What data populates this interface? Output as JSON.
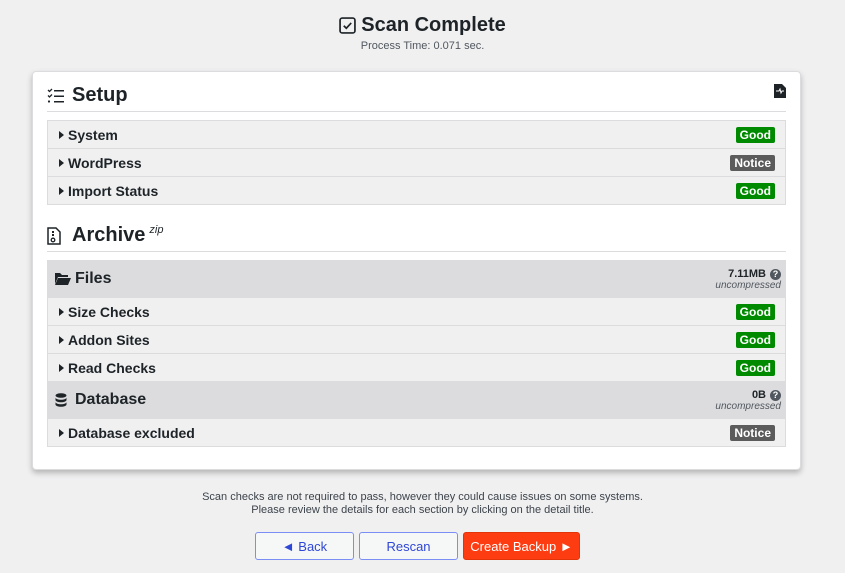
{
  "header": {
    "title": "Scan Complete",
    "title_icon": "check-square-icon",
    "process_time": "Process Time: 0.071 sec."
  },
  "setup": {
    "title": "Setup",
    "icon": "checklist-icon",
    "report_icon": "file-report-icon",
    "rows": [
      {
        "label": "System",
        "status": "Good"
      },
      {
        "label": "WordPress",
        "status": "Notice"
      },
      {
        "label": "Import Status",
        "status": "Good"
      }
    ]
  },
  "archive": {
    "title": "Archive",
    "format": "zip",
    "icon": "file-zip-icon",
    "files": {
      "title": "Files",
      "icon": "folder-open-icon",
      "size": "7.11MB",
      "size_note": "uncompressed",
      "rows": [
        {
          "label": "Size Checks",
          "status": "Good"
        },
        {
          "label": "Addon Sites",
          "status": "Good"
        },
        {
          "label": "Read Checks",
          "status": "Good"
        }
      ]
    },
    "database": {
      "title": "Database",
      "icon": "database-icon",
      "size": "0B",
      "size_note": "uncompressed",
      "rows": [
        {
          "label": "Database excluded",
          "status": "Notice"
        }
      ]
    }
  },
  "footer": {
    "note_line1": "Scan checks are not required to pass, however they could cause issues on some systems.",
    "note_line2": "Please review the details for each section by clicking on the detail title.",
    "back_label": "◄ Back",
    "rescan_label": "Rescan",
    "create_label": "Create Backup ►"
  },
  "colors": {
    "good": "#008a00",
    "notice": "#5b5b5b",
    "primary": "#fe3c11",
    "secondary_text": "#2f47d6"
  }
}
